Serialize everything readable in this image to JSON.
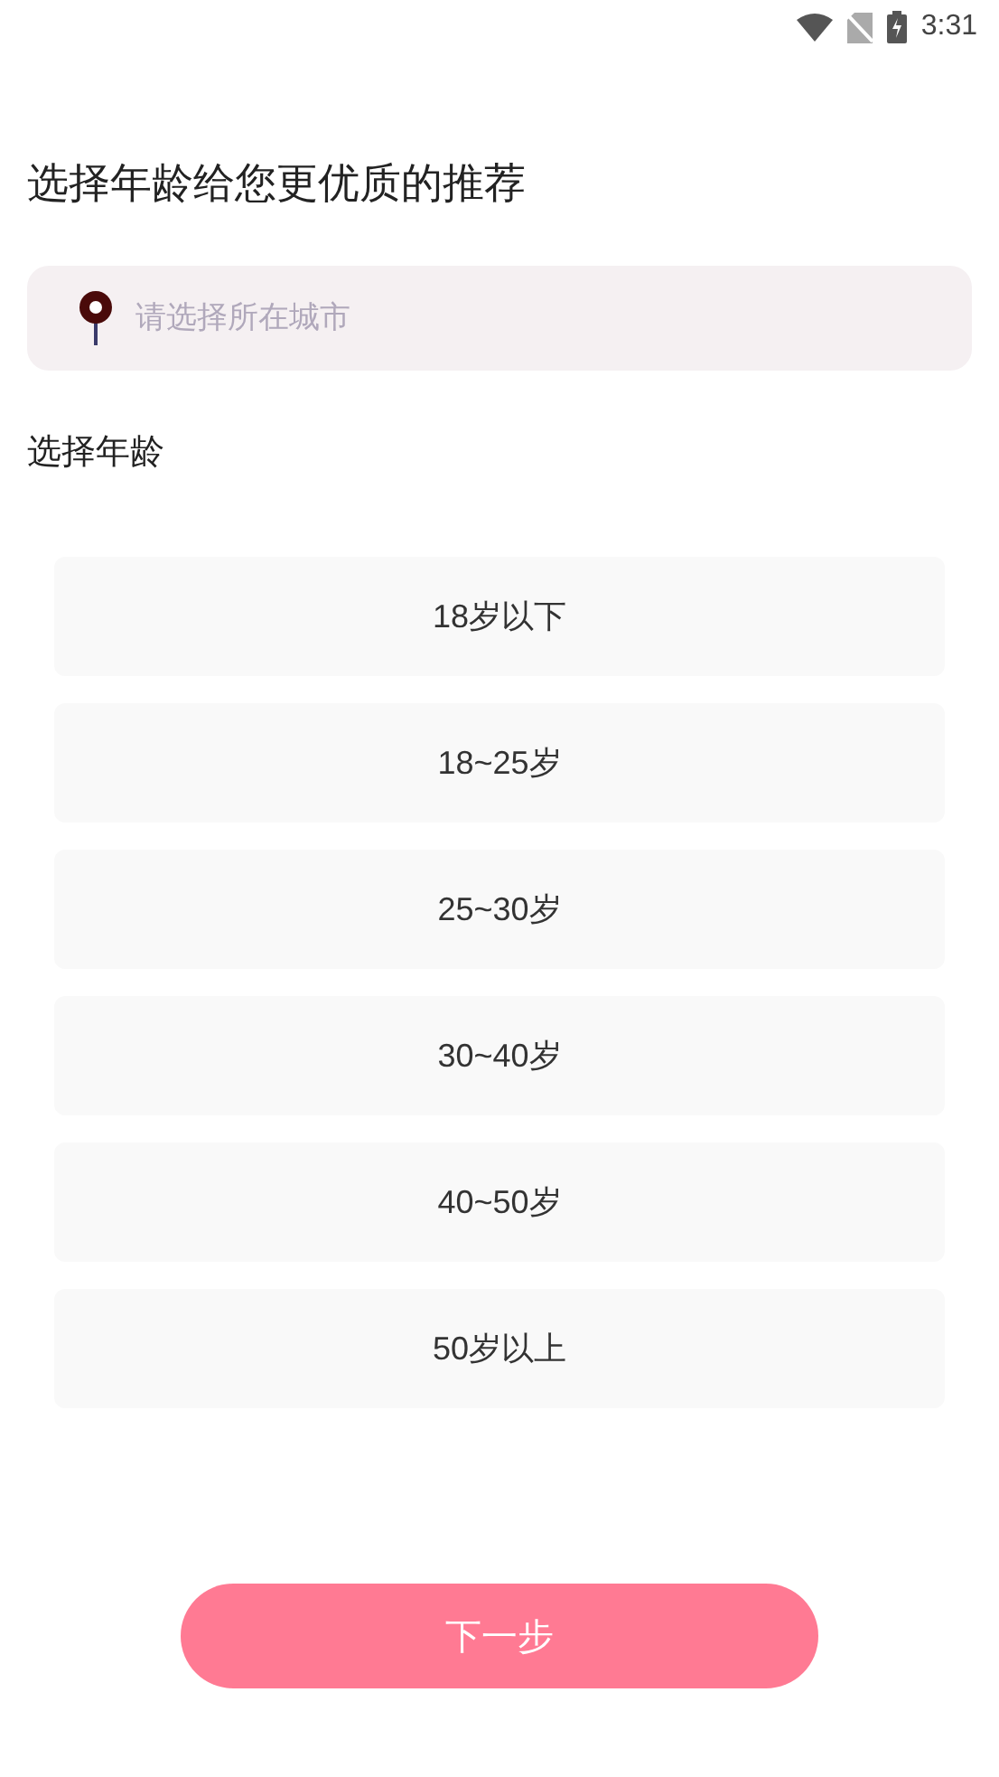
{
  "status_bar": {
    "time": "3:31"
  },
  "title": "选择年龄给您更优质的推荐",
  "city_field": {
    "placeholder": "请选择所在城市"
  },
  "age_label": "选择年龄",
  "age_options": [
    {
      "label": "18岁以下",
      "selected": false
    },
    {
      "label": "18~25岁",
      "selected": false
    },
    {
      "label": "25~30岁",
      "selected": false
    },
    {
      "label": "30~40岁",
      "selected": false
    },
    {
      "label": "40~50岁",
      "selected": false
    },
    {
      "label": "50岁以上",
      "selected": false
    }
  ],
  "next_button": {
    "label": "下一步"
  }
}
